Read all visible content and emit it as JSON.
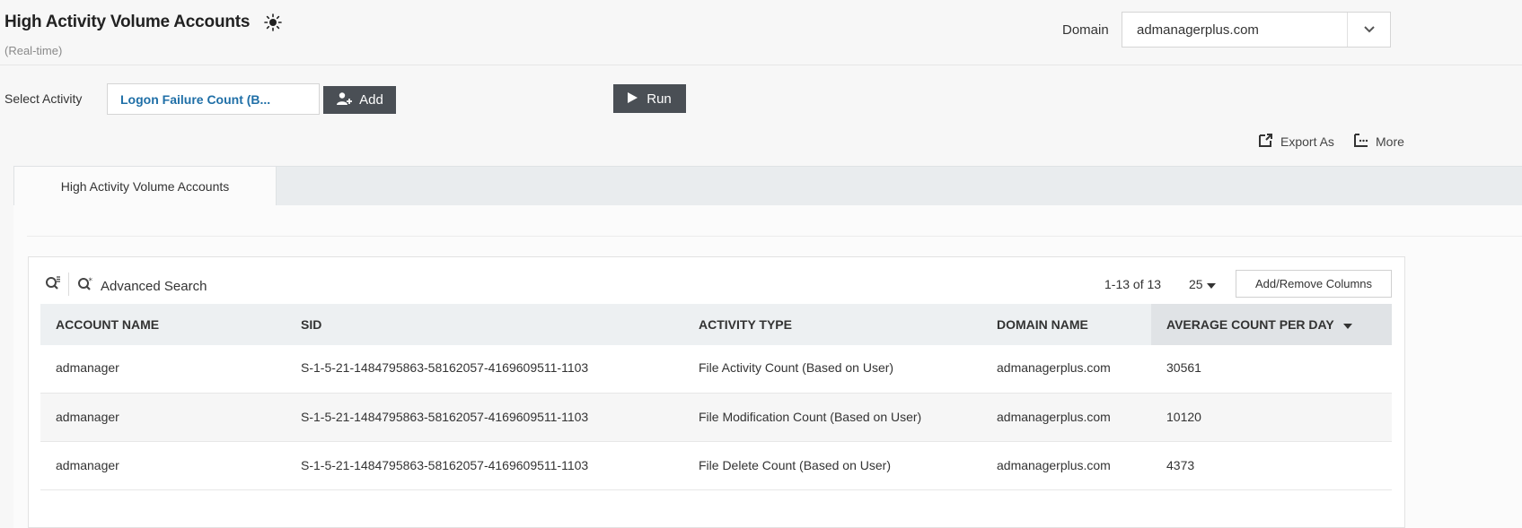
{
  "header": {
    "title": "High Activity Volume Accounts",
    "subtitle": "(Real-time)",
    "domain_label": "Domain",
    "domain_value": "admanagerplus.com"
  },
  "toolbar": {
    "select_activity_label": "Select Activity",
    "activity_value": "Logon Failure Count (B...",
    "add_label": "Add",
    "run_label": "Run",
    "export_label": "Export As",
    "more_label": "More"
  },
  "tabs": [
    {
      "label": "High Activity Volume Accounts",
      "active": true
    }
  ],
  "grid": {
    "advanced_search_label": "Advanced Search",
    "pagination": "1-13 of 13",
    "page_size": "25",
    "add_remove_columns_label": "Add/Remove Columns",
    "columns": [
      "ACCOUNT NAME",
      "SID",
      "ACTIVITY TYPE",
      "DOMAIN NAME",
      "AVERAGE COUNT PER DAY"
    ],
    "sorted_column": "AVERAGE COUNT PER DAY",
    "rows": [
      [
        "admanager",
        "S-1-5-21-1484795863-58162057-4169609511-1103",
        "File Activity Count (Based on User)",
        "admanagerplus.com",
        "30561"
      ],
      [
        "admanager",
        "S-1-5-21-1484795863-58162057-4169609511-1103",
        "File Modification Count (Based on User)",
        "admanagerplus.com",
        "10120"
      ],
      [
        "admanager",
        "S-1-5-21-1484795863-58162057-4169609511-1103",
        "File Delete Count (Based on User)",
        "admanagerplus.com",
        "4373"
      ]
    ]
  },
  "colors": {
    "accent_link": "#1f6fa7",
    "button_dark": "#4a4f55",
    "header_bg": "#edf0f2"
  },
  "icons": {
    "realtime": "sun-icon",
    "add": "add-user-icon",
    "run": "play-icon",
    "export": "export-icon",
    "more": "more-icon",
    "quick_search": "quick-search-icon",
    "advanced_search": "advanced-search-icon",
    "dropdown": "chevron-down-icon",
    "sort": "sort-desc-icon"
  }
}
